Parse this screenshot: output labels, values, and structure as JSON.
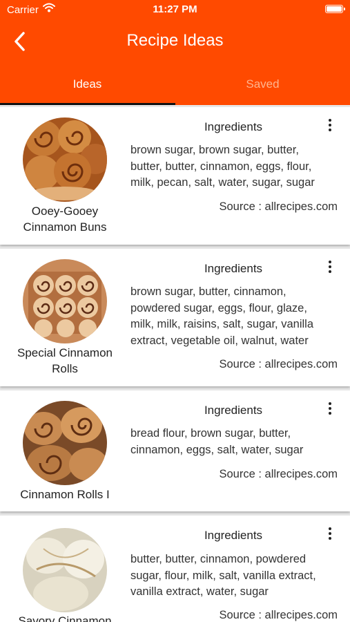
{
  "status_bar": {
    "carrier": "Carrier",
    "time": "11:27 PM"
  },
  "header": {
    "title": "Recipe Ideas",
    "back_icon": "chevron-left-icon"
  },
  "tabs": [
    {
      "label": "Ideas",
      "selected": true
    },
    {
      "label": "Saved",
      "selected": false
    }
  ],
  "recipes": [
    {
      "name_lines": [
        "Ooey-Gooey",
        "Cinnamon Buns"
      ],
      "ingredients_heading": "Ingredients",
      "ingredient_lines": [
        "brown sugar, brown sugar, butter,",
        "butter, butter, cinnamon, eggs, flour,",
        "milk, pecan, salt, water, sugar, sugar"
      ],
      "source": "Source : allrecipes.com"
    },
    {
      "name_lines": [
        "Special Cinnamon",
        "Rolls"
      ],
      "ingredients_heading": "Ingredients",
      "ingredient_lines": [
        "brown sugar, butter, cinnamon,",
        "powdered sugar, eggs, flour, glaze,",
        "milk, milk, raisins, salt, sugar, vanilla",
        "extract, vegetable oil, walnut, water"
      ],
      "source": "Source : allrecipes.com"
    },
    {
      "name_lines": [
        "Cinnamon Rolls I"
      ],
      "ingredients_heading": "Ingredients",
      "ingredient_lines": [
        "bread flour, brown sugar, butter,",
        "cinnamon, eggs, salt, water, sugar"
      ],
      "source": "Source : allrecipes.com"
    },
    {
      "name_lines": [
        "Savory Cinnamon"
      ],
      "ingredients_heading": "Ingredients",
      "ingredient_lines": [
        "butter, butter, cinnamon, powdered",
        "sugar, flour, milk, salt, vanilla extract,",
        "vanilla extract, water, sugar"
      ],
      "source": "Source : allrecipes.com"
    }
  ],
  "colors": {
    "header": "#ff4a00",
    "tab_inactive": "#ffb48f",
    "background": "#e9e9e9"
  }
}
